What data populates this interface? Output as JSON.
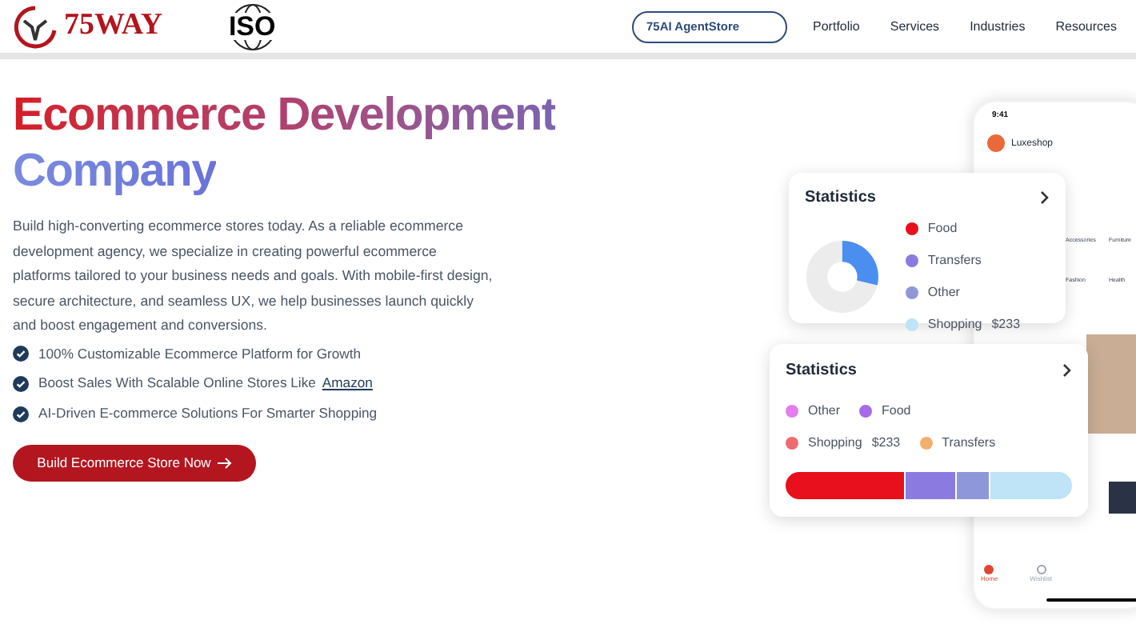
{
  "header": {
    "logo_text": "75WAY",
    "badge_text": "ISO",
    "agent_store": "75AI AgentStore",
    "nav": [
      {
        "label": "Portfolio"
      },
      {
        "label": "Services"
      },
      {
        "label": "Industries"
      },
      {
        "label": "Resources"
      }
    ]
  },
  "hero": {
    "title_line_1": "Ecommerce Development",
    "title_line_2": "Company",
    "description": "Build high-converting ecommerce stores today. As a reliable ecommerce development agency, we specialize in creating powerful ecommerce platforms tailored to your business needs and goals. With mobile-first design, secure architecture, and seamless UX, we help businesses launch quickly and boost engagement and conversions.",
    "features": [
      {
        "text": "100% Customizable Ecommerce Platform for Growth"
      },
      {
        "text": "Boost Sales With Scalable Online Stores Like",
        "link": "Amazon"
      },
      {
        "text": "AI-Driven E-commerce Solutions For Smarter Shopping"
      }
    ],
    "cta": "Build Ecommerce Store Now"
  },
  "phone": {
    "time": "9:41",
    "store_name": "Luxeshop",
    "categories": [
      {
        "label": "Accessories"
      },
      {
        "label": "Furniture"
      },
      {
        "label": "Fashion"
      },
      {
        "label": "Health"
      }
    ],
    "tabs": [
      {
        "label": "Home",
        "selected": true
      },
      {
        "label": "Wishlist",
        "selected": false
      }
    ]
  },
  "stats_card_1": {
    "title": "Statistics",
    "legend": [
      {
        "label": "Food",
        "color": "#e8101c"
      },
      {
        "label": "Transfers",
        "color": "#8b7be0"
      },
      {
        "label": "Other",
        "color": "#8e98d8"
      },
      {
        "label": "Shopping",
        "color": "#bfe3f7",
        "value": "$233"
      }
    ]
  },
  "stats_card_2": {
    "title": "Statistics",
    "legend": [
      {
        "label": "Other",
        "color": "#e27ef0"
      },
      {
        "label": "Food",
        "color": "#a86ae8"
      },
      {
        "label": "Shopping",
        "color": "#ef6b70",
        "value": "$233"
      },
      {
        "label": "Transfers",
        "color": "#f2b06e"
      }
    ]
  }
}
